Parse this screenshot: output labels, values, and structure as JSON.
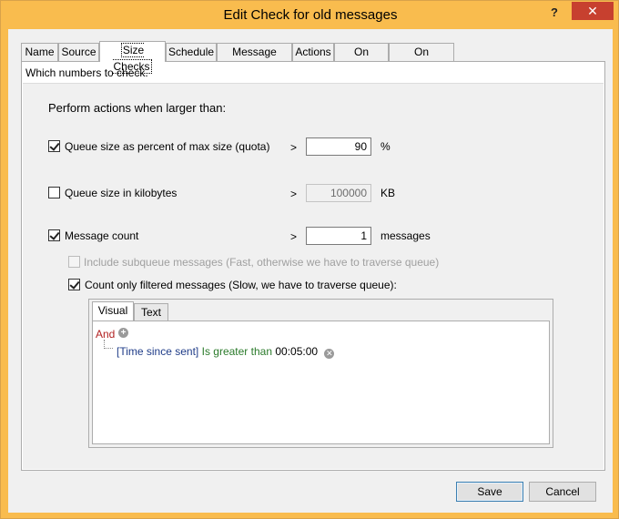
{
  "window": {
    "title": "Edit Check for old messages",
    "help_glyph": "?",
    "close_glyph": "✕",
    "accent_frame": "#f9bc4e",
    "close_color": "#c7402f"
  },
  "tabs": [
    {
      "label": "Name"
    },
    {
      "label": "Source"
    },
    {
      "label": "Size Checks",
      "active": true
    },
    {
      "label": "Schedule"
    },
    {
      "label": "Message Filter"
    },
    {
      "label": "Actions"
    },
    {
      "label": "On Failure"
    },
    {
      "label": "On Recovery"
    }
  ],
  "page": {
    "description": "Which numbers to check.",
    "heading": "Perform actions when larger than:",
    "queue_quota": {
      "checked": true,
      "label": "Queue size as percent of max size (quota)",
      "op": ">",
      "value": "90",
      "unit": "%"
    },
    "queue_kb": {
      "checked": false,
      "label": "Queue size in kilobytes",
      "op": ">",
      "value": "100000",
      "unit": "KB"
    },
    "msg_count": {
      "checked": true,
      "label": "Message count",
      "op": ">",
      "value": "1",
      "unit": "messages"
    },
    "subqueue": {
      "checked": false,
      "disabled": true,
      "label": "Include subqueue messages  (Fast, otherwise we have to traverse queue)"
    },
    "filtered": {
      "checked": true,
      "label": "Count only filtered messages (Slow, we have to traverse queue):"
    }
  },
  "filter_editor": {
    "tabs": [
      {
        "label": "Visual",
        "active": true
      },
      {
        "label": "Text"
      }
    ],
    "root_op": "And",
    "condition": {
      "field": "[Time since sent]",
      "operator": "Is greater than",
      "value": "00:05:00"
    },
    "icons": {
      "add": "plus-circle-icon",
      "remove": "x-circle-icon"
    }
  },
  "buttons": {
    "save": "Save",
    "cancel": "Cancel"
  }
}
